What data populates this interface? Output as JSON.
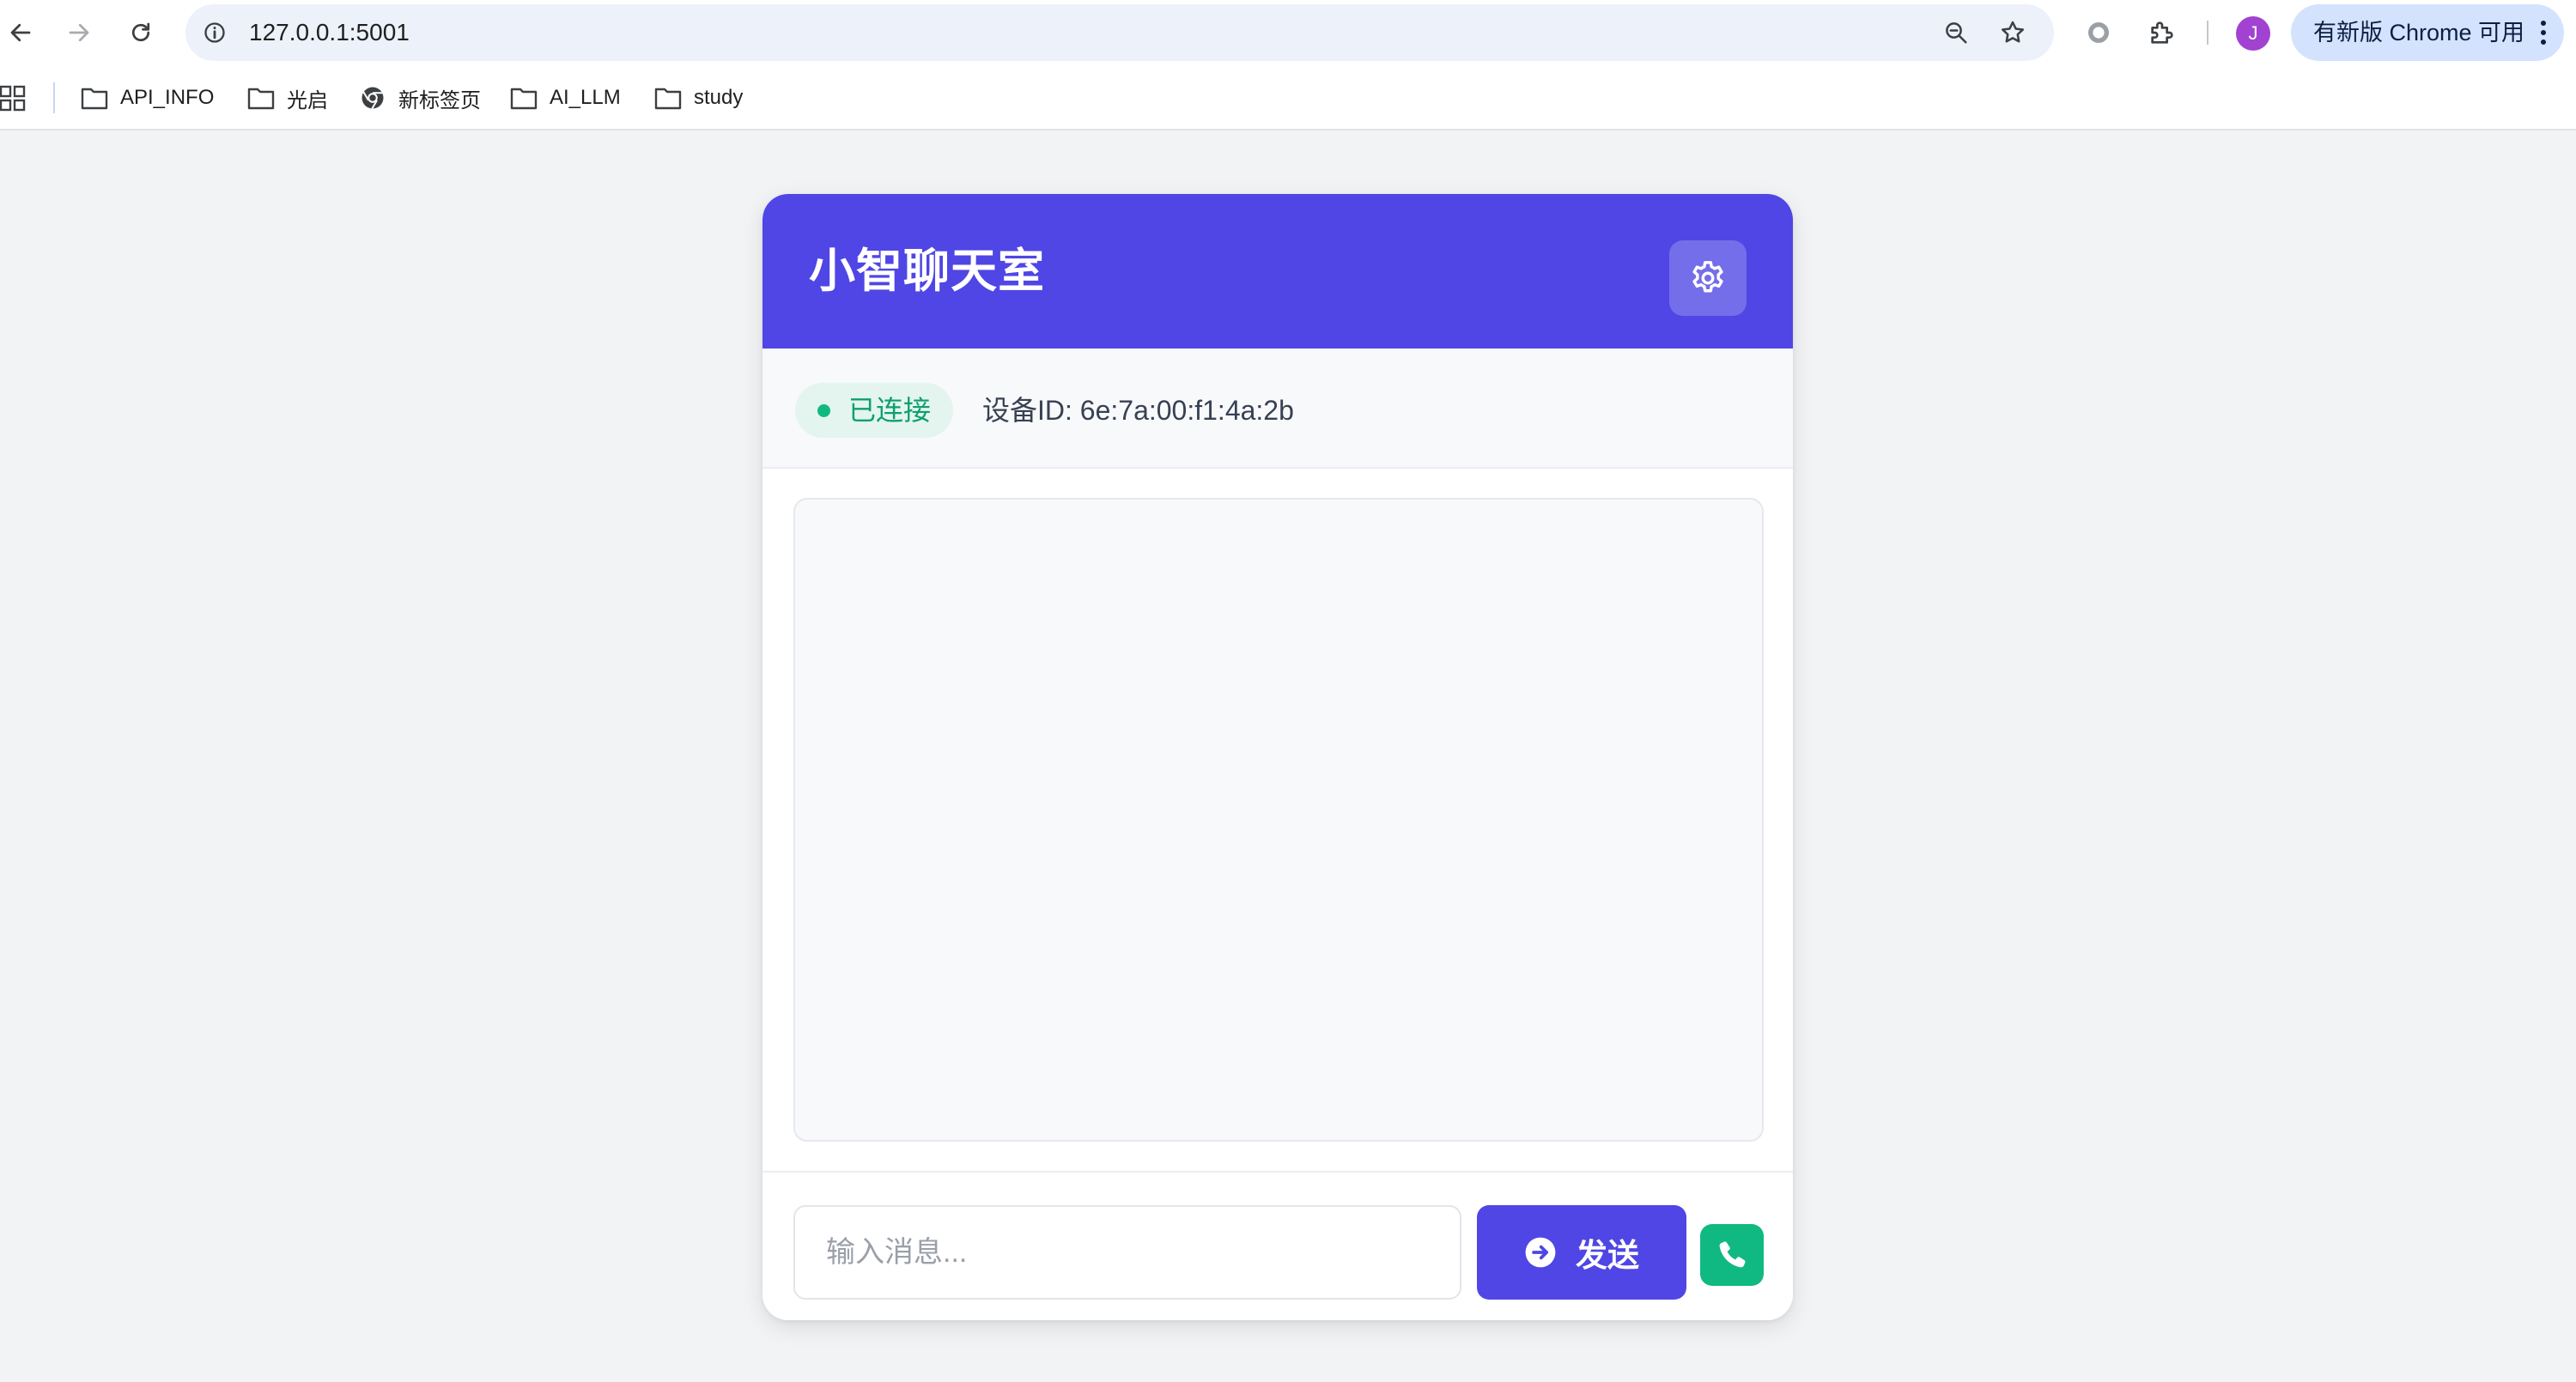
{
  "browser": {
    "url": "127.0.0.1:5001",
    "update_label": "有新版 Chrome 可用",
    "avatar_letter": "J",
    "bookmarks": [
      {
        "label": "API_INFO",
        "icon": "folder-icon"
      },
      {
        "label": "光启",
        "icon": "folder-icon"
      },
      {
        "label": "新标签页",
        "icon": "chrome-icon"
      },
      {
        "label": "AI_LLM",
        "icon": "folder-icon"
      },
      {
        "label": "study",
        "icon": "folder-icon"
      }
    ]
  },
  "chat": {
    "title": "小智聊天室",
    "status": {
      "label": "已连接",
      "device_id": "设备ID: 6e:7a:00:f1:4a:2b"
    },
    "input": {
      "placeholder": "输入消息...",
      "value": ""
    },
    "send_label": "发送"
  },
  "colors": {
    "accent": "#4f46e5",
    "success": "#10b981",
    "status_bg": "#e3f5ee"
  },
  "icons": {
    "settings": "gear-icon",
    "send": "arrow-right-circle-icon",
    "call": "phone-icon"
  }
}
